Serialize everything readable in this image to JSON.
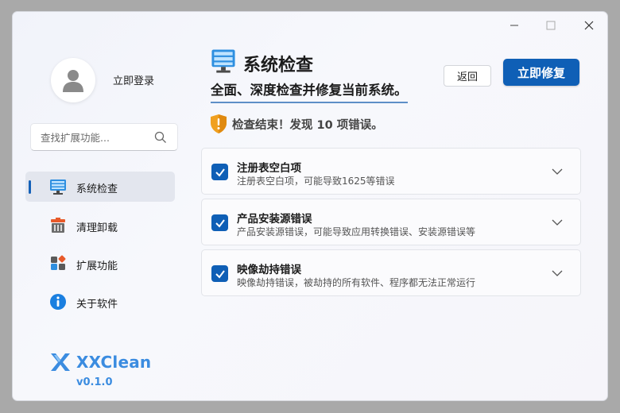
{
  "sidebar": {
    "login_label": "立即登录",
    "search_placeholder": "查找扩展功能...",
    "items": [
      {
        "label": "系统检查",
        "icon": "monitor-check-icon"
      },
      {
        "label": "清理卸载",
        "icon": "trash-cleanup-icon"
      },
      {
        "label": "扩展功能",
        "icon": "extensions-icon"
      },
      {
        "label": "关于软件",
        "icon": "info-icon"
      }
    ],
    "brand_name": "XXClean",
    "version": "v0.1.0"
  },
  "main": {
    "title": "系统检查",
    "subtitle": "全面、深度检查并修复当前系统。",
    "back_label": "返回",
    "fix_label": "立即修复",
    "result_text": "检查结束！发现 10 项错误。",
    "issues": [
      {
        "title": "注册表空白项",
        "desc": "注册表空白项，可能导致1625等错误",
        "checked": true
      },
      {
        "title": "产品安装源错误",
        "desc": "产品安装源错误，可能导致应用转换错误、安装源错误等",
        "checked": true
      },
      {
        "title": "映像劫持错误",
        "desc": "映像劫持错误，被劫持的所有软件、程序都无法正常运行",
        "checked": true
      }
    ]
  },
  "colors": {
    "accent": "#0f5fb6",
    "brand": "#3b8ce0",
    "warning": "#f0a020"
  }
}
